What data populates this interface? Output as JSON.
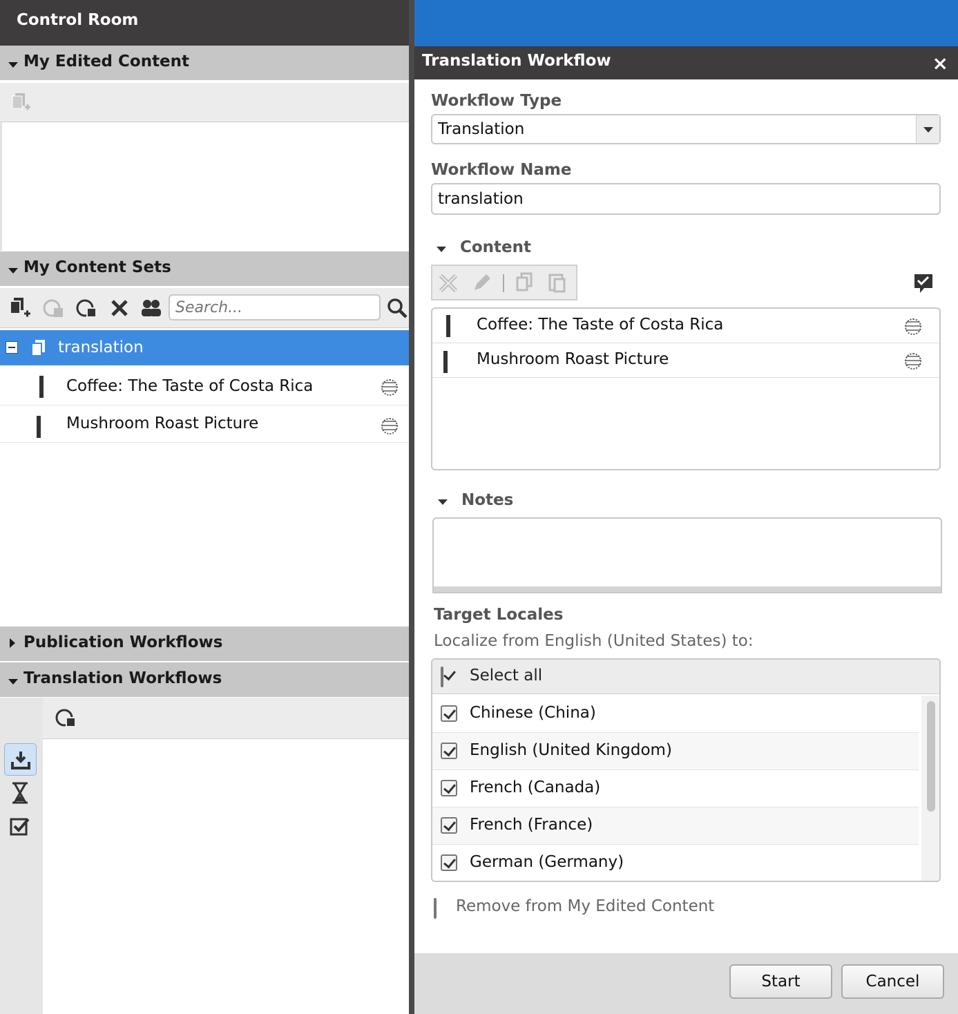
{
  "left_panel": {
    "title": "Control Room",
    "sections": {
      "my_edited_content": {
        "label": "My Edited Content",
        "expanded": true
      },
      "my_content_sets": {
        "label": "My Content Sets",
        "expanded": true,
        "search_placeholder": "Search..."
      },
      "publication_workflows": {
        "label": "Publication Workflows",
        "expanded": false
      },
      "translation_workflows": {
        "label": "Translation Workflows",
        "expanded": true
      }
    },
    "tree": {
      "selected_set": "translation",
      "items": [
        {
          "label": "Coffee: The Taste of Costa Rica",
          "type": "article"
        },
        {
          "label": "Mushroom Roast Picture",
          "type": "picture"
        }
      ]
    }
  },
  "dialog": {
    "title": "Translation Workflow",
    "close_glyph": "×",
    "workflow_type": {
      "label": "Workflow Type",
      "value": "Translation"
    },
    "workflow_name": {
      "label": "Workflow Name",
      "value": "translation"
    },
    "content": {
      "label": "Content",
      "items": [
        {
          "label": "Coffee: The Taste of Costa Rica",
          "type": "article"
        },
        {
          "label": "Mushroom Roast Picture",
          "type": "picture"
        }
      ]
    },
    "notes": {
      "label": "Notes",
      "value": ""
    },
    "target_locales": {
      "label": "Target Locales",
      "subtitle": "Localize from English (United States) to:",
      "select_all": {
        "label": "Select all",
        "checked": true
      },
      "locales": [
        {
          "label": "Chinese (China)",
          "checked": true
        },
        {
          "label": "English (United Kingdom)",
          "checked": true
        },
        {
          "label": "French (Canada)",
          "checked": true
        },
        {
          "label": "French (France)",
          "checked": true
        },
        {
          "label": "German (Germany)",
          "checked": true
        }
      ]
    },
    "remove_option": {
      "label": "Remove from My Edited Content",
      "checked": false
    },
    "buttons": {
      "start": "Start",
      "cancel": "Cancel"
    }
  },
  "colors": {
    "header_dark": "#3e3c3d",
    "accent_blue": "#2173c9",
    "selection_blue": "#3d8be0",
    "section_gray": "#c6c6c6"
  }
}
